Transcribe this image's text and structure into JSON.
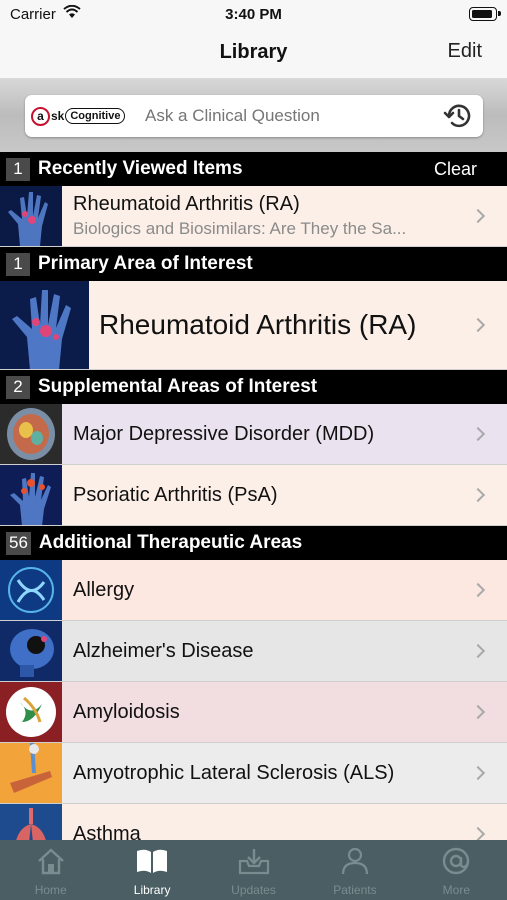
{
  "status": {
    "carrier": "Carrier",
    "time": "3:40 PM"
  },
  "nav": {
    "title": "Library",
    "edit_label": "Edit"
  },
  "search": {
    "logo_ask_prefix": "sk",
    "logo_cognitive": "Cognitive",
    "placeholder": "Ask a Clinical Question"
  },
  "sections": {
    "recent": {
      "count": "1",
      "label": "Recently Viewed Items",
      "clear_label": "Clear"
    },
    "primary": {
      "count": "1",
      "label": "Primary Area of Interest"
    },
    "supplemental": {
      "count": "2",
      "label": "Supplemental Areas of Interest"
    },
    "additional": {
      "count": "56",
      "label": "Additional Therapeutic Areas"
    }
  },
  "recent_items": [
    {
      "title": "Rheumatoid Arthritis (RA)",
      "subtitle": "Biologics and Biosimilars: Are They the Sa..."
    }
  ],
  "primary_items": [
    {
      "title": "Rheumatoid Arthritis (RA)"
    }
  ],
  "supplemental_items": [
    {
      "title": "Major Depressive Disorder (MDD)",
      "bg": "#ebe2ef"
    },
    {
      "title": "Psoriatic Arthritis (PsA)",
      "bg": "#fbefe7"
    }
  ],
  "additional_items": [
    {
      "title": "Allergy",
      "bg": "#fde7e1"
    },
    {
      "title": "Alzheimer's Disease",
      "bg": "#e6e6e6"
    },
    {
      "title": "Amyloidosis",
      "bg": "#f2dde1"
    },
    {
      "title": "Amyotrophic Lateral Sclerosis (ALS)",
      "bg": "#ececec"
    },
    {
      "title": "Asthma",
      "bg": "#fbeee7"
    }
  ],
  "tabs": [
    {
      "label": "Home",
      "icon": "home-icon"
    },
    {
      "label": "Library",
      "icon": "book-icon",
      "active": true
    },
    {
      "label": "Updates",
      "icon": "inbox-download-icon"
    },
    {
      "label": "Patients",
      "icon": "person-icon"
    },
    {
      "label": "More",
      "icon": "at-sign-icon"
    }
  ]
}
